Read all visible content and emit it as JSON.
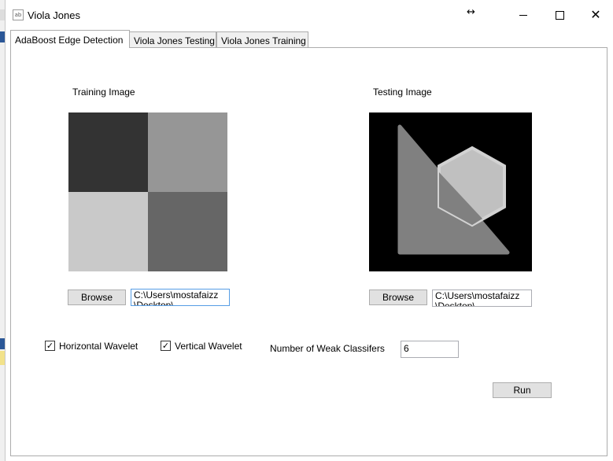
{
  "window": {
    "title": "Viola Jones",
    "icon": "app-icon",
    "controls": {
      "resize": "↔",
      "close": "✕"
    }
  },
  "tabs": [
    {
      "label": "AdaBoost Edge Detection",
      "active": true
    },
    {
      "label": "Viola Jones Testing",
      "active": false
    },
    {
      "label": "Viola Jones Training",
      "active": false
    }
  ],
  "training": {
    "label": "Training Image",
    "image_colors": [
      "#333333",
      "#969696",
      "#c9c9c9",
      "#666666"
    ],
    "browse_label": "Browse",
    "path": "C:\\Users\\mostafaizz\n\\Desktop\\..."
  },
  "testing": {
    "label": "Testing Image",
    "image_colors": {
      "background": "#000000",
      "triangle": "#808080",
      "hexagon": "#c0c0c0",
      "outline": "#d2d2d2"
    },
    "browse_label": "Browse",
    "path": "C:\\Users\\mostafaizz\n\\Desktop\\..."
  },
  "options": {
    "horizontal_wavelet": {
      "label": "Horizontal Wavelet",
      "checked": true
    },
    "vertical_wavelet": {
      "label": "Vertical Wavelet",
      "checked": true
    },
    "weak_classifiers": {
      "label": "Number of Weak Classifers",
      "value": "6"
    }
  },
  "run_label": "Run"
}
